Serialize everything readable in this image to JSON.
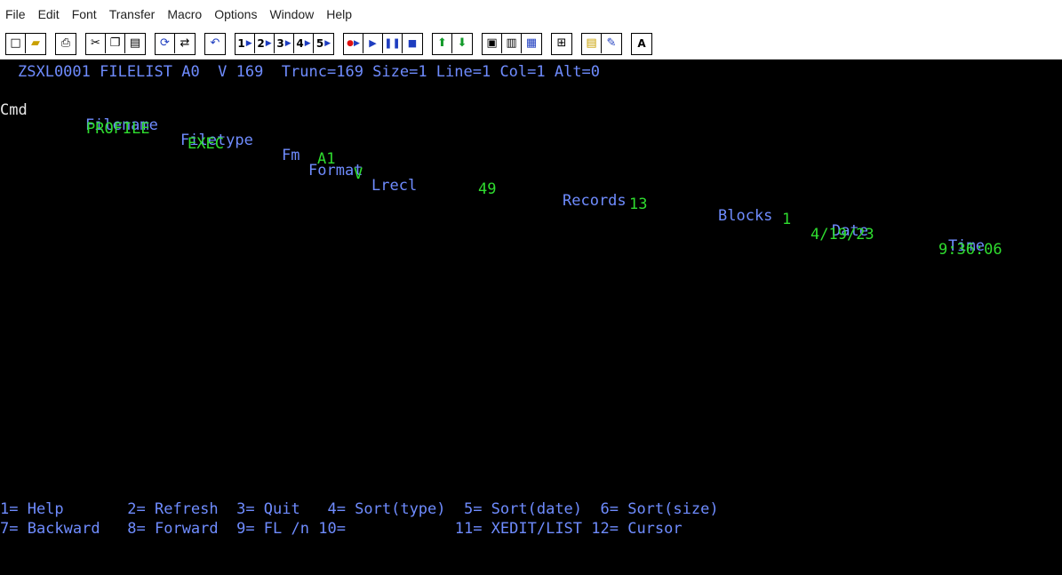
{
  "menu": [
    "File",
    "Edit",
    "Font",
    "Transfer",
    "Macro",
    "Options",
    "Window",
    "Help"
  ],
  "toolbar": {
    "macro_numbers": [
      "1",
      "2",
      "3",
      "4",
      "5"
    ],
    "last_button_label": "A"
  },
  "terminal": {
    "header": "ZSXL0001 FILELIST A0  V 169  Trunc=169 Size=1 Line=1 Col=1 Alt=0",
    "columns": {
      "cmd": "Cmd",
      "filename": "Filename",
      "filetype": "Filetype",
      "fm": "Fm",
      "format": "Format",
      "lrecl": "Lrecl",
      "records": "Records",
      "blocks": "Blocks",
      "date": "Date",
      "time": "Time"
    },
    "files": [
      {
        "filename": "PROFILE",
        "filetype": "EXEC",
        "fm": "A1",
        "format": "V",
        "lrecl": "49",
        "records": "13",
        "blocks": "1",
        "date": "4/19/23",
        "time": "9:36:06"
      }
    ],
    "pf_keys_row1": "1= Help       2= Refresh  3= Quit   4= Sort(type)  5= Sort(date)  6= Sort(size)",
    "pf_keys_row2": "7= Backward   8= Forward  9= FL /n 10=            11= XEDIT/LIST 12= Cursor",
    "command_prompt": "====>"
  }
}
